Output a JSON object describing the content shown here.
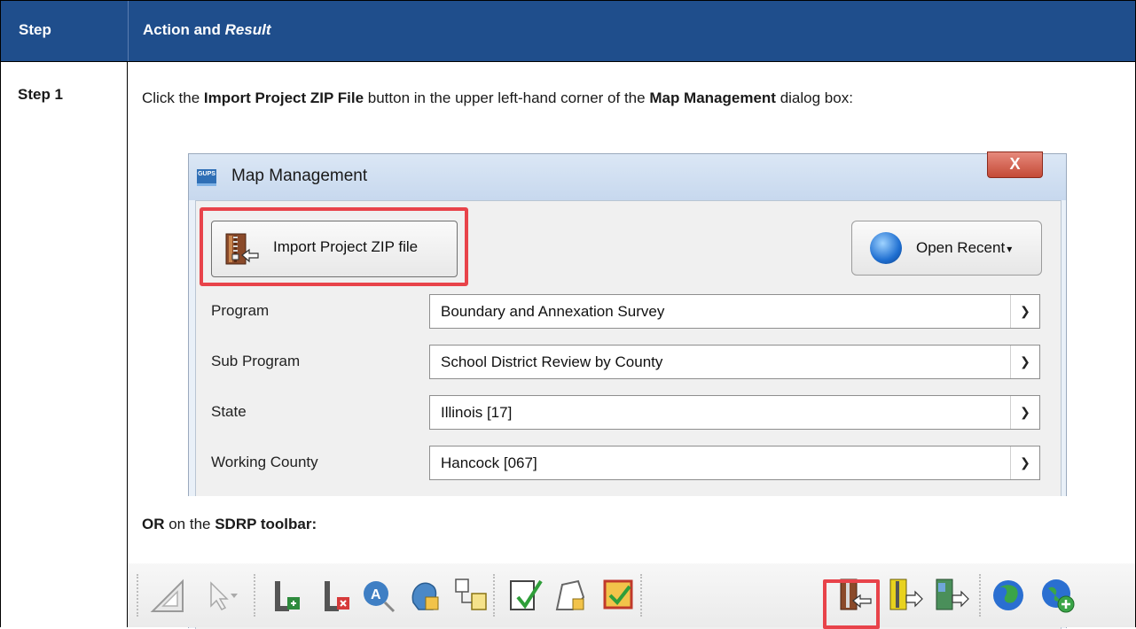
{
  "table": {
    "header_step": "Step",
    "header_action": "Action and ",
    "header_result": "Result",
    "step_label": "Step 1"
  },
  "instruction": {
    "part1": "Click the ",
    "button_name": "Import Project ZIP File",
    "part2": " button in the upper left-hand corner of the ",
    "dialog_name": "Map Management",
    "part3": " dialog box:"
  },
  "dialog": {
    "logo_text": "GUPS",
    "title": "Map Management",
    "close_label": "X",
    "import_label": "Import Project ZIP file",
    "recent_label": "Open Recent",
    "fields": [
      {
        "label": "Program",
        "value": "Boundary and Annexation Survey"
      },
      {
        "label": "Sub Program",
        "value": "School District Review by County"
      },
      {
        "label": "State",
        "value": "Illinois [17]"
      },
      {
        "label": "Working County",
        "value": "Hancock [067]"
      }
    ]
  },
  "or_line": {
    "or": "OR",
    "middle": " on the ",
    "toolbar_name": "SDRP toolbar:"
  },
  "toolbar": {
    "icons": [
      "triangle-ruler-icon",
      "cursor-dropdown-icon",
      "add-layer-icon",
      "remove-layer-icon",
      "attribute-search-icon",
      "identify-head-icon",
      "grid-icon",
      "validate-check-icon",
      "shape-lock-icon",
      "review-icon",
      "import-zip-icon",
      "export-zip-icon",
      "export-map-icon",
      "globe-icon",
      "add-globe-icon"
    ]
  },
  "colors": {
    "header_bg": "#1f4e8c",
    "highlight": "#e8434a"
  }
}
